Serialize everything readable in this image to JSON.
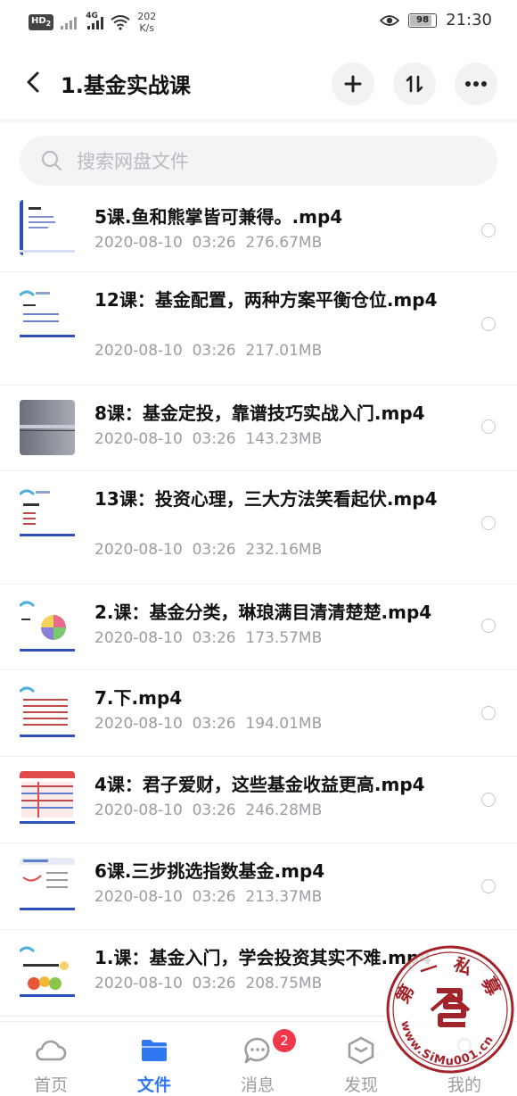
{
  "status_bar": {
    "hd_label": "HD",
    "hd_sub": "2",
    "network_label": "4G",
    "speed_value": "202",
    "speed_unit": "K/s",
    "battery": "98",
    "time": "21:30"
  },
  "header": {
    "title": "1.基金实战课",
    "back_icon": "back-arrow-icon",
    "add_icon": "plus-icon",
    "sort_icon": "sort-icon",
    "more_icon": "more-icon"
  },
  "search": {
    "placeholder": "搜索网盘文件",
    "value": ""
  },
  "files": [
    {
      "name": "5课.鱼和熊掌皆可兼得。.mp4",
      "date": "2020-08-10",
      "time": "03:26",
      "size": "276.67MB"
    },
    {
      "name": "12课：基金配置，两种方案平衡仓位.mp4",
      "date": "2020-08-10",
      "time": "03:26",
      "size": "217.01MB"
    },
    {
      "name": "8课：基金定投，靠谱技巧实战入门.mp4",
      "date": "2020-08-10",
      "time": "03:26",
      "size": "143.23MB"
    },
    {
      "name": "13课：投资心理，三大方法笑看起伏.mp4",
      "date": "2020-08-10",
      "time": "03:26",
      "size": "232.16MB"
    },
    {
      "name": "2.课：基金分类，琳琅满目清清楚楚.mp4",
      "date": "2020-08-10",
      "time": "03:26",
      "size": "173.57MB"
    },
    {
      "name": "7.下.mp4",
      "date": "2020-08-10",
      "time": "03:26",
      "size": "194.01MB"
    },
    {
      "name": "4课：君子爱财，这些基金收益更高.mp4",
      "date": "2020-08-10",
      "time": "03:26",
      "size": "246.28MB"
    },
    {
      "name": "6课.三步挑选指数基金.mp4",
      "date": "2020-08-10",
      "time": "03:26",
      "size": "213.37MB"
    },
    {
      "name": "1.课：基金入门，学会投资其实不难.mp4",
      "date": "2020-08-10",
      "time": "03:26",
      "size": "208.75MB"
    }
  ],
  "nav": {
    "items": [
      {
        "label": "首页",
        "icon": "cloud-icon"
      },
      {
        "label": "文件",
        "icon": "folder-icon"
      },
      {
        "label": "消息",
        "icon": "chat-bubble-icon",
        "badge": "2"
      },
      {
        "label": "发现",
        "icon": "cube-icon"
      },
      {
        "label": "我的",
        "icon": "user-icon"
      }
    ],
    "active": "文件"
  },
  "watermark": {
    "text_top": "第一私募",
    "text_bottom": "www.SiMu001.cn"
  },
  "colors": {
    "accent": "#2f78f2",
    "badge": "#f0384a",
    "muted": "#9a9da3",
    "watermark": "#a3232a"
  }
}
